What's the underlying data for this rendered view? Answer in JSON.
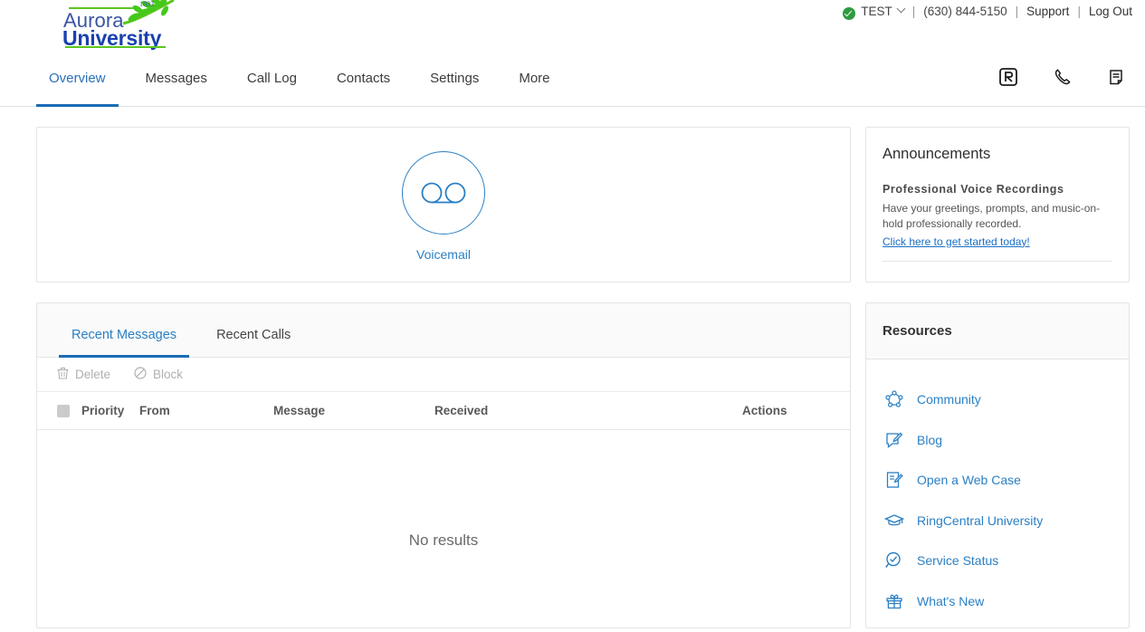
{
  "brand": {
    "line1": "Aurora",
    "line2": "University",
    "year": "1893",
    "logo_icon": "laurel-leaf-icon"
  },
  "utility": {
    "status_icon": "green-check-icon",
    "account": "TEST",
    "caret_icon": "chevron-down-icon",
    "phone": "(630) 844-5150",
    "support": "Support",
    "logout": "Log Out",
    "separator": "|"
  },
  "nav": {
    "tabs": [
      {
        "label": "Overview",
        "active": true
      },
      {
        "label": "Messages",
        "active": false
      },
      {
        "label": "Call Log",
        "active": false
      },
      {
        "label": "Contacts",
        "active": false
      },
      {
        "label": "Settings",
        "active": false
      },
      {
        "label": "More",
        "active": false
      }
    ],
    "icons": [
      {
        "name": "ringcentral-logo-icon"
      },
      {
        "name": "phone-handset-icon"
      },
      {
        "name": "fax-document-icon"
      }
    ]
  },
  "voicemail": {
    "icon": "voicemail-icon",
    "label": "Voicemail"
  },
  "messages_panel": {
    "tabs": [
      {
        "label": "Recent Messages",
        "active": true
      },
      {
        "label": "Recent Calls",
        "active": false
      }
    ],
    "toolbar": [
      {
        "label": "Delete",
        "icon": "trash-icon",
        "enabled": false
      },
      {
        "label": "Block",
        "icon": "block-circle-slash-icon",
        "enabled": false
      }
    ],
    "columns": [
      "Priority",
      "From",
      "Message",
      "Received",
      "Actions"
    ],
    "rows": [],
    "empty_text": "No results"
  },
  "announcements": {
    "title": "Announcements",
    "subtitle": "Professional Voice Recordings",
    "body": "Have your greetings, prompts, and music-on-hold professionally recorded.",
    "link": "Click here to get started today!"
  },
  "resources": {
    "title": "Resources",
    "items": [
      {
        "label": "Community",
        "icon": "community-network-icon"
      },
      {
        "label": "Blog",
        "icon": "blog-pencil-icon"
      },
      {
        "label": "Open a Web Case",
        "icon": "web-case-document-icon"
      },
      {
        "label": "RingCentral University",
        "icon": "graduation-cap-icon"
      },
      {
        "label": "Service Status",
        "icon": "magnifier-check-icon"
      },
      {
        "label": "What's New",
        "icon": "gift-box-icon"
      }
    ]
  },
  "colors": {
    "accent_blue": "#2a7fc4",
    "active_underline": "#1b6cb5",
    "brand_blue": "#1940b0",
    "brand_green": "#5cc61f",
    "status_green": "#2e9b3f",
    "border": "#e4e4e4"
  }
}
